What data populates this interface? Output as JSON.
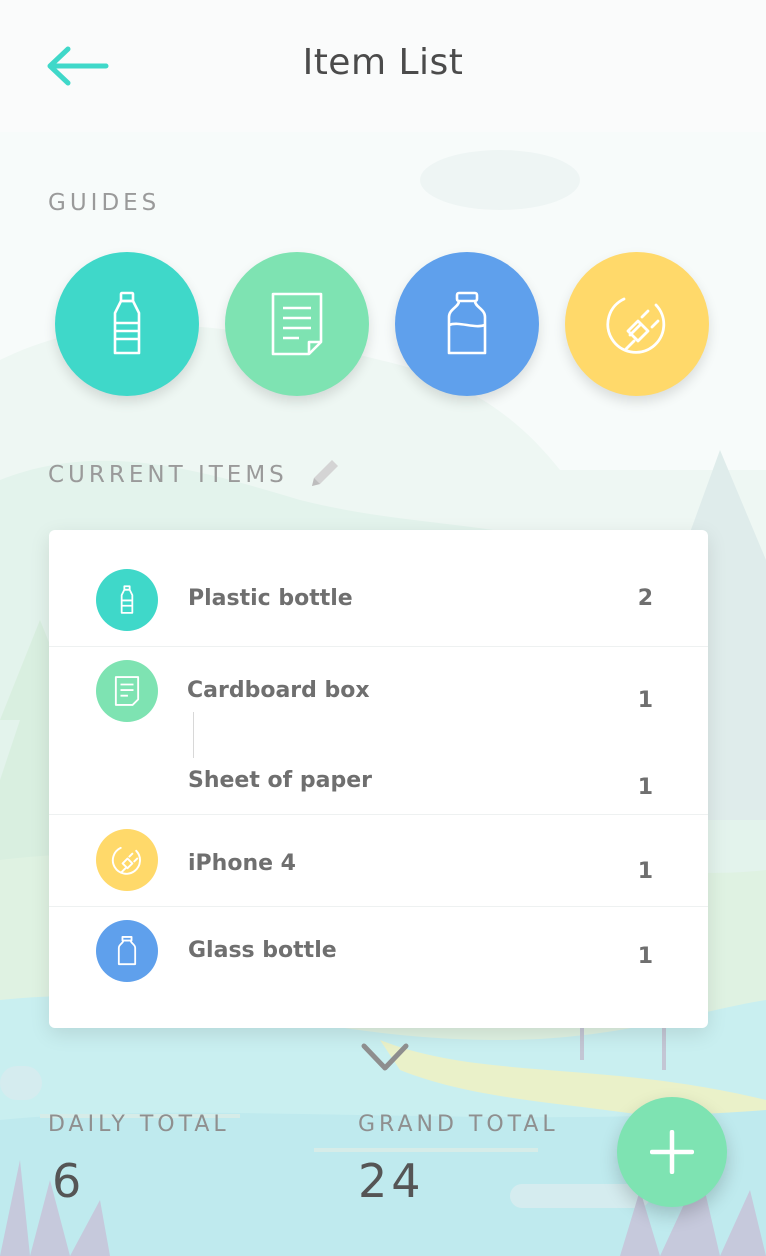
{
  "header": {
    "title": "Item List",
    "back_icon": "arrow-left-icon"
  },
  "guides": {
    "label": "GUIDES",
    "items": [
      {
        "icon": "plastic-bottle-icon",
        "color": "#3fd8c9"
      },
      {
        "icon": "paper-document-icon",
        "color": "#7ee3b2"
      },
      {
        "icon": "glass-bottle-icon",
        "color": "#5fa0ec"
      },
      {
        "icon": "plug-icon",
        "color": "#ffd96a"
      }
    ]
  },
  "current_items": {
    "label": "CURRENT ITEMS",
    "edit_icon": "pencil-icon",
    "rows": [
      {
        "name": "Plastic bottle",
        "count": "2",
        "icon": "plastic-bottle-icon",
        "color": "#3fd8c9"
      },
      {
        "name": "Cardboard box",
        "count": "1",
        "icon": "paper-document-icon",
        "color": "#7ee3b2"
      },
      {
        "name": "Sheet of paper",
        "count": "1"
      },
      {
        "name": "iPhone 4",
        "count": "1",
        "icon": "plug-icon",
        "color": "#ffd96a"
      },
      {
        "name": "Glass bottle",
        "count": "1",
        "icon": "glass-bottle-icon",
        "color": "#5fa0ec"
      }
    ]
  },
  "totals": {
    "daily_label": "DAILY TOTAL",
    "daily_value": "6",
    "grand_label": "GRAND TOTAL",
    "grand_value": "24"
  },
  "actions": {
    "expand_icon": "chevron-down-icon",
    "add_icon": "plus-icon"
  },
  "colors": {
    "accent": "#3fd8c9",
    "fab": "#7ee3b2"
  }
}
